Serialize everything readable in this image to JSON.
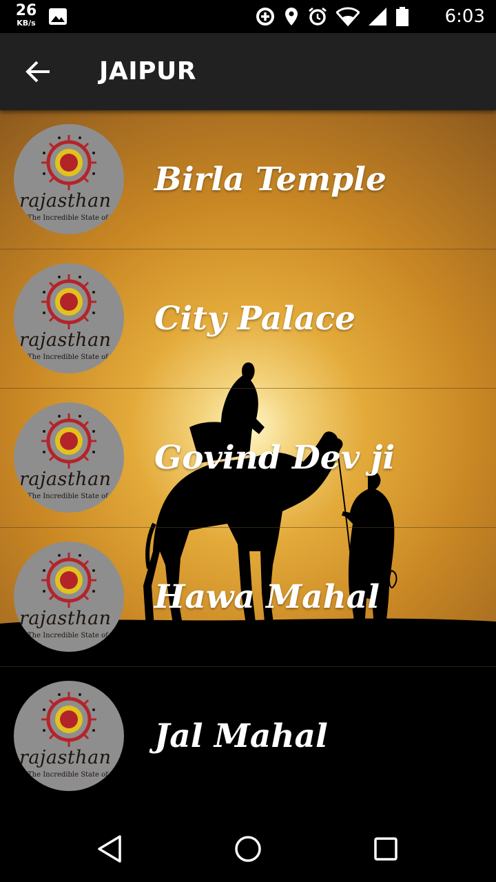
{
  "status_bar": {
    "net_speed_value": "26",
    "net_speed_unit": "KB/s",
    "time": "6:03",
    "icons": [
      "image-icon",
      "data-saver-icon",
      "location-icon",
      "alarm-icon",
      "wifi-icon",
      "signal-icon",
      "battery-icon"
    ]
  },
  "app_bar": {
    "title": "JAIPUR",
    "back_icon": "arrow-back-icon"
  },
  "places": [
    {
      "name": "Birla Temple",
      "logo_word": "rajasthan",
      "logo_tagline": "The Incredible State of India"
    },
    {
      "name": "City Palace",
      "logo_word": "rajasthan",
      "logo_tagline": "The Incredible State of India"
    },
    {
      "name": "Govind Dev ji",
      "logo_word": "rajasthan",
      "logo_tagline": "The Incredible State of India"
    },
    {
      "name": "Hawa Mahal",
      "logo_word": "rajasthan",
      "logo_tagline": "The Incredible State of India"
    },
    {
      "name": "Jal Mahal",
      "logo_word": "rajasthan",
      "logo_tagline": "The Incredible State of India"
    }
  ],
  "nav_bar": {
    "icons": [
      "back-triangle-icon",
      "home-circle-icon",
      "recents-square-icon"
    ]
  },
  "colors": {
    "app_bar": "#212121",
    "sunset_glow": "#e3aa3a",
    "logo_red": "#b3242a",
    "logo_yellow": "#e2c21d"
  }
}
